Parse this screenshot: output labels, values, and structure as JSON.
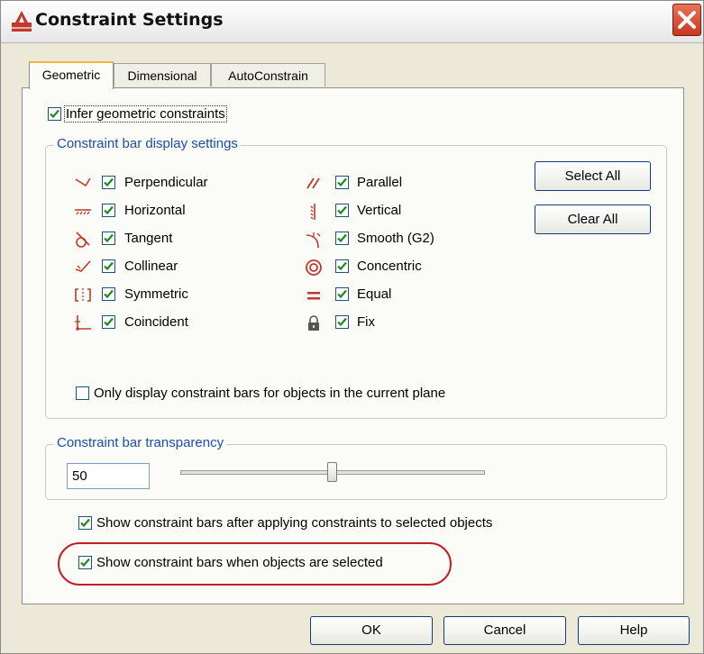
{
  "window": {
    "title": "Constraint Settings",
    "app_icon": "autocad-icon",
    "close_icon": "close-icon"
  },
  "tabs": [
    {
      "label": "Geometric",
      "active": true
    },
    {
      "label": "Dimensional",
      "active": false
    },
    {
      "label": "AutoConstrain",
      "active": false
    }
  ],
  "infer": {
    "label": "Infer geometric constraints",
    "checked": true
  },
  "display_group": {
    "title": "Constraint bar display settings",
    "left_column": [
      {
        "label": "Perpendicular",
        "icon": "perpendicular-icon",
        "checked": true
      },
      {
        "label": "Horizontal",
        "icon": "horizontal-icon",
        "checked": true
      },
      {
        "label": "Tangent",
        "icon": "tangent-icon",
        "checked": true
      },
      {
        "label": "Collinear",
        "icon": "collinear-icon",
        "checked": true
      },
      {
        "label": "Symmetric",
        "icon": "symmetric-icon",
        "checked": true
      },
      {
        "label": "Coincident",
        "icon": "coincident-icon",
        "checked": true
      }
    ],
    "right_column": [
      {
        "label": "Parallel",
        "icon": "parallel-icon",
        "checked": true
      },
      {
        "label": "Vertical",
        "icon": "vertical-icon",
        "checked": true
      },
      {
        "label": "Smooth (G2)",
        "icon": "smooth-icon",
        "checked": true
      },
      {
        "label": "Concentric",
        "icon": "concentric-icon",
        "checked": true
      },
      {
        "label": "Equal",
        "icon": "equal-icon",
        "checked": true
      },
      {
        "label": "Fix",
        "icon": "lock-icon",
        "checked": true
      }
    ],
    "select_all": "Select All",
    "clear_all": "Clear All",
    "current_plane": {
      "label": "Only display constraint bars for objects in the current plane",
      "checked": false
    }
  },
  "transparency_group": {
    "title": "Constraint bar transparency",
    "value": "50",
    "slider_fraction": 0.5
  },
  "show_after_apply": {
    "label": "Show constraint bars after applying constraints to selected objects",
    "checked": true
  },
  "show_when_selected": {
    "label": "Show constraint bars when objects are selected",
    "checked": true
  },
  "buttons": {
    "ok": "OK",
    "cancel": "Cancel",
    "help": "Help"
  },
  "colors": {
    "accent_red": "#c21f24",
    "group_title_blue": "#1b4ea8",
    "check_green": "#1a8a1a"
  }
}
